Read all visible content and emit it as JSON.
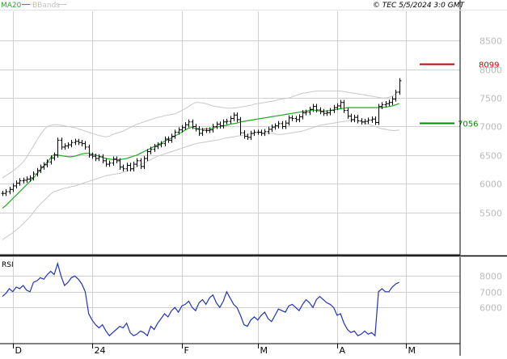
{
  "header": {
    "legend_ma": "MA20",
    "legend_bbands": "BBands",
    "source": "© TEC 5/5/2024 3:0 GMT"
  },
  "colors": {
    "ma": "#22aa22",
    "bbands": "#c8c8c8",
    "price": "#000000",
    "resistance": "#cc0000",
    "support": "#008800",
    "rsi": "#2233bb",
    "grid": "#d0d0d0",
    "axis_text": "#bbbbbb",
    "frame": "#000000"
  },
  "chart_data": [
    {
      "type": "ohlc",
      "title": "",
      "xlabel": "",
      "ylabel": "",
      "ylim": [
        4800,
        9000
      ],
      "y_ticks": [
        5500,
        6000,
        6500,
        7000,
        7500,
        8000,
        8500
      ],
      "y_tick_labels": [
        "5500",
        "6000",
        "6500",
        "7000",
        "7500",
        "8000",
        "8500"
      ],
      "x_ticks": [
        {
          "label": "D",
          "index": 3
        },
        {
          "label": "24",
          "index": 26
        },
        {
          "label": "F",
          "index": 52
        },
        {
          "label": "M",
          "index": 74
        },
        {
          "label": "A",
          "index": 97
        },
        {
          "label": "M",
          "index": 117
        }
      ],
      "x_count": 121,
      "close": [
        5830,
        5860,
        5900,
        5960,
        6010,
        6050,
        6060,
        6080,
        6100,
        6170,
        6230,
        6290,
        6330,
        6380,
        6450,
        6500,
        6760,
        6640,
        6660,
        6680,
        6720,
        6740,
        6720,
        6700,
        6640,
        6500,
        6480,
        6440,
        6470,
        6400,
        6340,
        6360,
        6430,
        6400,
        6290,
        6260,
        6320,
        6260,
        6340,
        6400,
        6300,
        6440,
        6560,
        6600,
        6650,
        6680,
        6700,
        6780,
        6760,
        6830,
        6900,
        6940,
        6980,
        7030,
        7080,
        7000,
        6960,
        6880,
        6930,
        6930,
        6940,
        7000,
        7040,
        7010,
        7080,
        7090,
        7140,
        7200,
        7120,
        6890,
        6830,
        6810,
        6880,
        6900,
        6900,
        6880,
        6910,
        6950,
        6990,
        7010,
        7050,
        7000,
        7060,
        7150,
        7140,
        7120,
        7170,
        7240,
        7250,
        7300,
        7350,
        7290,
        7260,
        7230,
        7240,
        7280,
        7330,
        7360,
        7420,
        7280,
        7180,
        7120,
        7160,
        7100,
        7080,
        7090,
        7110,
        7130,
        7070,
        7350,
        7380,
        7400,
        7420,
        7480,
        7600,
        7800
      ],
      "series": [
        {
          "name": "MA20",
          "values": [
            5570,
            5620,
            5680,
            5740,
            5800,
            5860,
            5920,
            5980,
            6040,
            6100,
            6170,
            6240,
            6310,
            6380,
            6450,
            6510,
            6500,
            6490,
            6480,
            6470,
            6470,
            6480,
            6500,
            6520,
            6530,
            6530,
            6520,
            6500,
            6480,
            6460,
            6440,
            6430,
            6420,
            6420,
            6420,
            6430,
            6440,
            6460,
            6480,
            6500,
            6530,
            6560,
            6590,
            6620,
            6650,
            6680,
            6710,
            6740,
            6770,
            6800,
            6830,
            6870,
            6900,
            6940,
            6970,
            6990,
            6960,
            6950,
            6950,
            6960,
            6960,
            6970,
            6990,
            7000,
            7010,
            7020,
            7040,
            7050,
            7060,
            7080,
            7090,
            7100,
            7110,
            7120,
            7130,
            7140,
            7150,
            7160,
            7170,
            7180,
            7190,
            7200,
            7210,
            7220,
            7230,
            7240,
            7250,
            7260,
            7270,
            7280,
            7290,
            7280,
            7270,
            7270,
            7270,
            7280,
            7290,
            7300,
            7310,
            7320,
            7330,
            7330,
            7330,
            7330,
            7330,
            7330,
            7330,
            7330,
            7330,
            7330,
            7330,
            7340,
            7350,
            7360,
            7380,
            7400
          ]
        },
        {
          "name": "BBands upper",
          "values": [
            6100,
            6140,
            6180,
            6220,
            6270,
            6320,
            6380,
            6460,
            6560,
            6660,
            6760,
            6860,
            6940,
            7000,
            7020,
            7030,
            7030,
            7020,
            7010,
            7000,
            6990,
            6980,
            6960,
            6940,
            6920,
            6900,
            6880,
            6860,
            6840,
            6830,
            6820,
            6830,
            6860,
            6880,
            6900,
            6920,
            6950,
            6980,
            7010,
            7040,
            7060,
            7080,
            7100,
            7120,
            7140,
            7160,
            7170,
            7190,
            7200,
            7210,
            7220,
            7250,
            7280,
            7310,
            7350,
            7390,
            7420,
            7420,
            7410,
            7400,
            7380,
            7360,
            7350,
            7340,
            7330,
            7320,
            7320,
            7320,
            7330,
            7340,
            7350,
            7360,
            7370,
            7390,
            7400,
            7410,
            7420,
            7430,
            7440,
            7450,
            7470,
            7480,
            7490,
            7500,
            7520,
            7540,
            7560,
            7580,
            7590,
            7600,
            7610,
            7620,
            7620,
            7620,
            7620,
            7620,
            7620,
            7620,
            7620,
            7610,
            7600,
            7590,
            7580,
            7570,
            7560,
            7550,
            7540,
            7530,
            7520,
            7510,
            7500,
            7500,
            7510,
            7530,
            7570,
            7620
          ]
        },
        {
          "name": "BBands lower",
          "values": [
            5020,
            5060,
            5100,
            5140,
            5190,
            5240,
            5300,
            5360,
            5420,
            5500,
            5580,
            5640,
            5700,
            5760,
            5820,
            5860,
            5880,
            5900,
            5920,
            5930,
            5950,
            5960,
            5980,
            6000,
            6020,
            6040,
            6060,
            6080,
            6100,
            6120,
            6140,
            6150,
            6160,
            6170,
            6180,
            6200,
            6220,
            6240,
            6270,
            6300,
            6330,
            6360,
            6390,
            6420,
            6450,
            6480,
            6500,
            6520,
            6540,
            6560,
            6580,
            6600,
            6620,
            6640,
            6660,
            6680,
            6700,
            6710,
            6720,
            6730,
            6740,
            6750,
            6760,
            6770,
            6790,
            6800,
            6810,
            6820,
            6830,
            6840,
            6850,
            6860,
            6870,
            6880,
            6880,
            6880,
            6880,
            6880,
            6880,
            6870,
            6860,
            6860,
            6870,
            6880,
            6890,
            6900,
            6910,
            6920,
            6940,
            6960,
            6980,
            7000,
            7020,
            7030,
            7040,
            7050,
            7060,
            7070,
            7080,
            7090,
            7100,
            7110,
            7110,
            7100,
            7080,
            7060,
            7040,
            7020,
            7000,
            6980,
            6960,
            6950,
            6940,
            6930,
            6930,
            6940
          ]
        }
      ],
      "levels": [
        {
          "label": "8099",
          "value": 8099
        },
        {
          "label": "7056",
          "value": 7056
        }
      ]
    },
    {
      "type": "line",
      "title": "RSI",
      "ylim": [
        38,
        90
      ],
      "y_ticks": [
        60,
        70,
        80
      ],
      "y_tick_labels": [
        "6000",
        "7000",
        "8000"
      ],
      "x_count": 121,
      "series": [
        {
          "name": "RSI",
          "values": [
            67,
            69,
            72,
            70,
            73,
            72,
            74,
            71,
            70,
            76,
            77,
            79,
            78,
            81,
            83,
            81,
            88,
            80,
            74,
            76,
            79,
            80,
            78,
            75,
            70,
            56,
            52,
            49,
            47,
            49,
            45,
            42,
            44,
            46,
            48,
            47,
            50,
            44,
            42,
            43,
            45,
            44,
            42,
            48,
            46,
            50,
            53,
            56,
            54,
            58,
            60,
            57,
            61,
            62,
            64,
            60,
            58,
            63,
            65,
            62,
            66,
            68,
            63,
            60,
            64,
            70,
            66,
            62,
            60,
            55,
            49,
            48,
            52,
            54,
            52,
            55,
            57,
            53,
            51,
            55,
            59,
            58,
            57,
            61,
            62,
            60,
            58,
            62,
            65,
            63,
            60,
            65,
            67,
            65,
            63,
            62,
            60,
            55,
            56,
            50,
            46,
            44,
            45,
            42,
            43,
            45,
            43,
            44,
            42,
            70,
            72,
            70,
            70,
            73,
            75,
            76
          ]
        }
      ]
    }
  ]
}
